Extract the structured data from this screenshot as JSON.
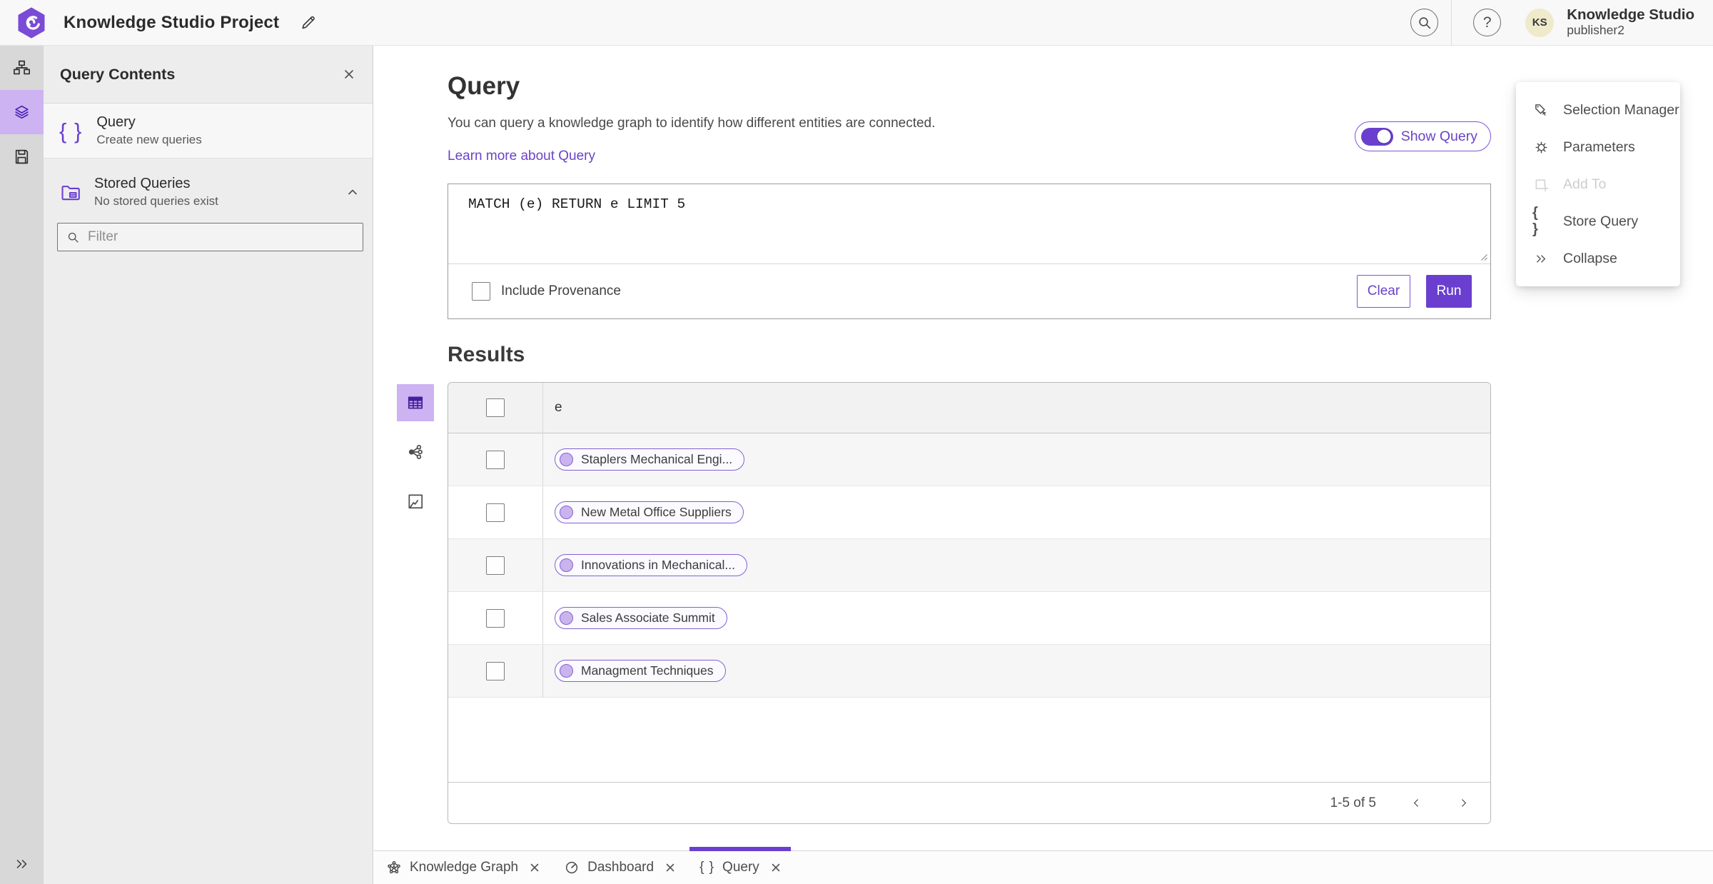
{
  "header": {
    "project_title": "Knowledge Studio Project",
    "app_name": "Knowledge Studio",
    "user_role": "publisher2",
    "avatar_initials": "KS",
    "help_glyph": "?"
  },
  "contents_panel": {
    "title": "Query Contents",
    "query_item": {
      "title": "Query",
      "subtitle": "Create new queries"
    },
    "stored_item": {
      "title": "Stored Queries",
      "subtitle": "No stored queries exist"
    },
    "filter_placeholder": "Filter"
  },
  "query_section": {
    "title": "Query",
    "description": "You can query a knowledge graph to identify how different entities are connected.",
    "learn_more_label": "Learn more about Query",
    "show_query_label": "Show Query",
    "query_text": "MATCH (e) RETURN e LIMIT 5",
    "include_provenance_label": "Include Provenance",
    "clear_label": "Clear",
    "run_label": "Run"
  },
  "results_section": {
    "title": "Results",
    "column_header": "e",
    "rows": [
      "Staplers Mechanical Engi...",
      "New Metal Office Suppliers",
      "Innovations in Mechanical...",
      "Sales Associate Summit",
      "Managment Techniques"
    ],
    "pagination_label": "1-5 of 5"
  },
  "side_menu": {
    "items": [
      {
        "label": "Selection Manager",
        "disabled": false
      },
      {
        "label": "Parameters",
        "disabled": false
      },
      {
        "label": "Add To",
        "disabled": true
      },
      {
        "label": "Store Query",
        "disabled": false
      },
      {
        "label": "Collapse",
        "disabled": false
      }
    ]
  },
  "tabs": {
    "items": [
      {
        "label": "Knowledge Graph",
        "active": false
      },
      {
        "label": "Dashboard",
        "active": false
      },
      {
        "label": "Query",
        "active": true
      }
    ]
  },
  "icons": {
    "logo": "purple-hexagon-swirl",
    "rail": [
      "data-model-icon",
      "layers-icon",
      "save-icon"
    ],
    "rail_bottom": "double-chevron-right-icon",
    "header_icons": [
      "edit-pencil-icon",
      "search-icon",
      "help-icon"
    ],
    "view_switcher": [
      "table-icon",
      "link-chart-icon",
      "map-icon"
    ],
    "side_menu_icons": [
      "selection-manager-icon",
      "gear-icon",
      "add-to-icon",
      "braces-icon",
      "double-chevron-right-icon"
    ],
    "tab_icons": [
      "knowledge-graph-icon",
      "dashboard-gauge-icon",
      "braces-icon"
    ]
  },
  "colors": {
    "accent": "#6a3fd0",
    "accent_text": "#6a43c8",
    "accent_light_bg": "#cdb3f2",
    "pill_border": "#8560d2",
    "pill_dot": "#c9b4ed",
    "avatar_bg": "#eeeacb",
    "header_bg": "#f8f8f8",
    "rail_bg": "#d8d8d8",
    "panel_bg": "#ededed",
    "table_header_bg": "#f2f2f2",
    "row_alt_bg": "#f6f6f6"
  }
}
